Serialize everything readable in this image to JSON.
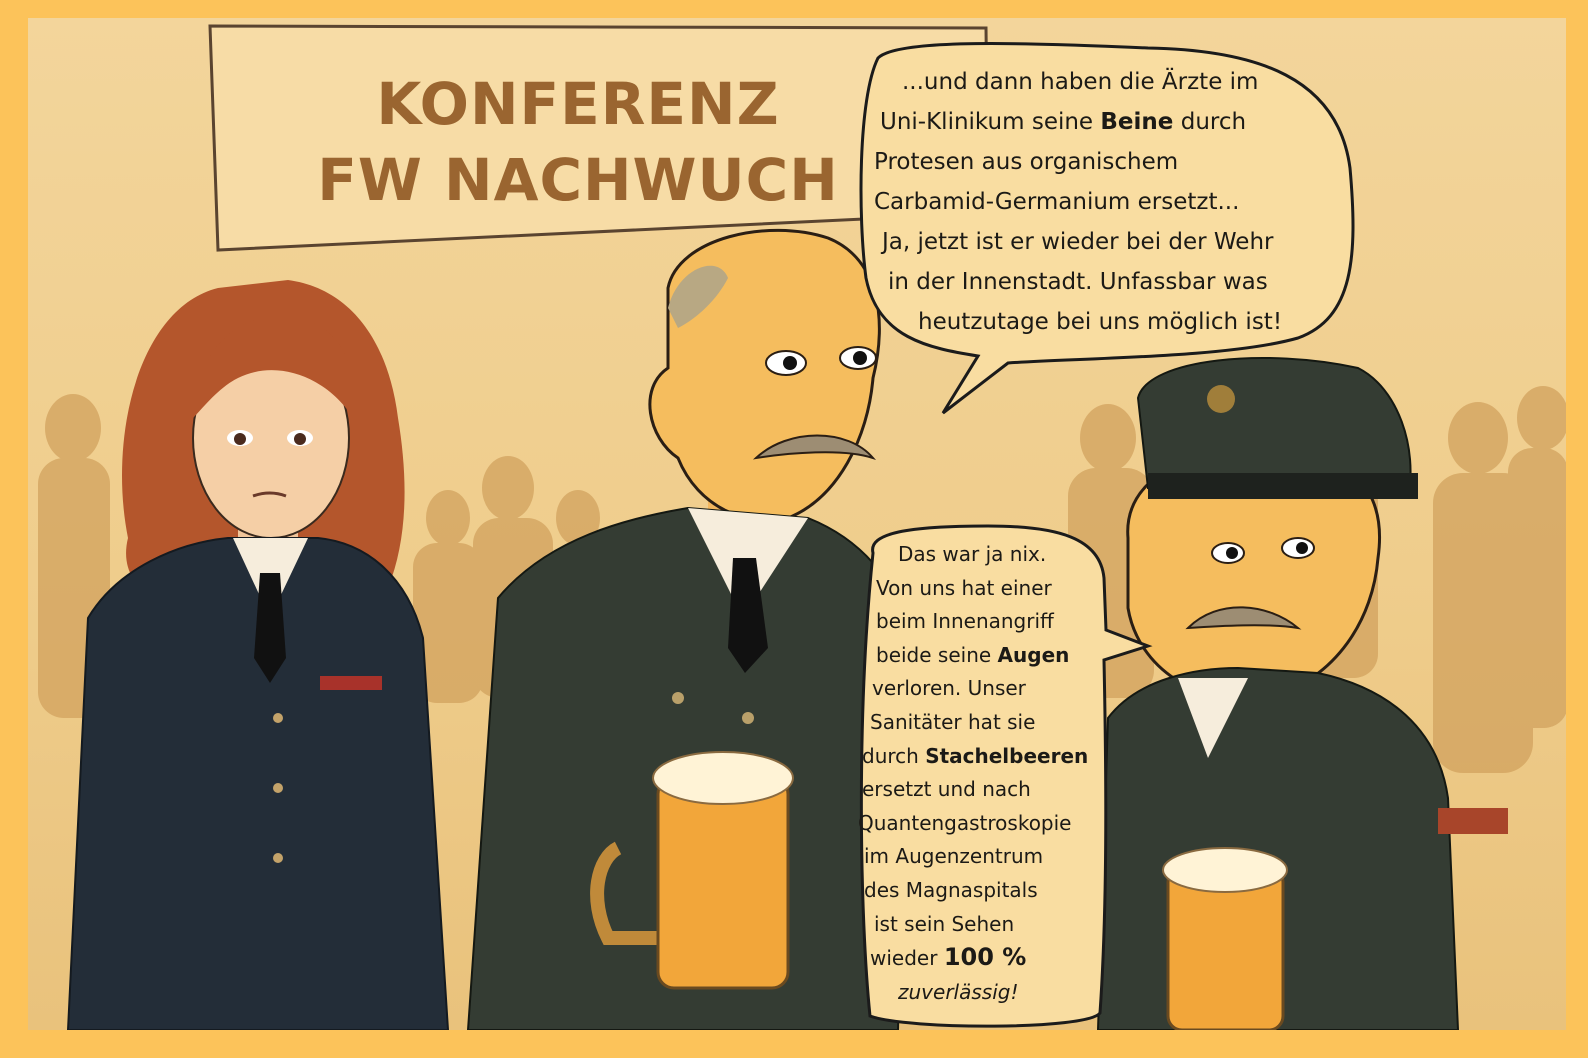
{
  "banner": {
    "line1": "KONFERENZ",
    "line2": "FW NACHWUCH"
  },
  "bubble_top": {
    "line1": "...und dann haben die Ärzte im",
    "line2_pre": "Uni-Klinikum seine ",
    "line2_bold": "Beine",
    "line2_post": " durch",
    "line3": "Protesen aus organischem",
    "line4": "Carbamid-Germanium ersetzt...",
    "line5": "Ja, jetzt ist er wieder bei der Wehr",
    "line6": "in der Innenstadt. Unfassbar was",
    "line7": "heutzutage bei uns möglich ist!"
  },
  "bubble_bottom": {
    "line1": "Das war ja nix.",
    "line2": "Von uns hat einer",
    "line3": "beim Innenangriff",
    "line4_pre": "beide seine ",
    "line4_bold": "Augen",
    "line5": "verloren. Unser",
    "line6": "Sanitäter hat sie",
    "line7_pre": "durch ",
    "line7_bold": "Stachelbeeren",
    "line8": "ersetzt und nach",
    "line9": "Quantengastroskopie",
    "line10": "im Augenzentrum",
    "line11": "des Magnaspitals",
    "line12": "ist sein Sehen",
    "line13_pre": "wieder ",
    "line13_bold": "100 %",
    "line14": "zuverlässig!"
  },
  "colors": {
    "frame": "#fcc35a",
    "background": "#f0cf8f",
    "banner_text": "#9a6530",
    "uniform_navy": "#232d38",
    "uniform_olive": "#343c33",
    "beer": "#f2a63a"
  }
}
